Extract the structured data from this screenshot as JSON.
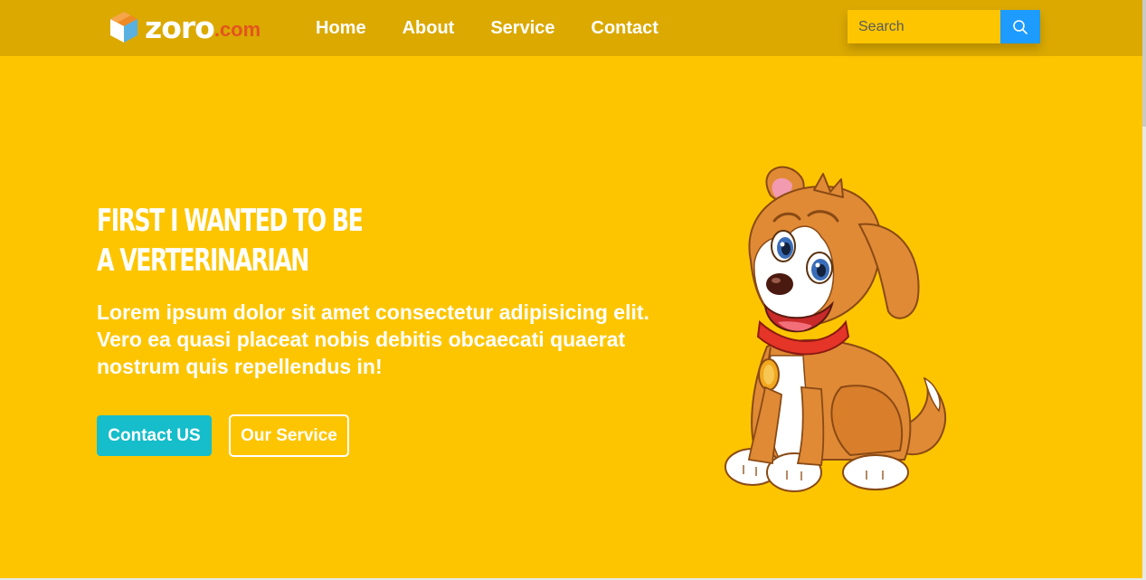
{
  "header": {
    "logo": {
      "name": "zoro",
      "suffix": ".com"
    },
    "nav": [
      {
        "label": "Home"
      },
      {
        "label": "About"
      },
      {
        "label": "Service"
      },
      {
        "label": "Contact"
      }
    ],
    "search": {
      "placeholder": "Search",
      "value": ""
    }
  },
  "hero": {
    "title_line1": "FIRST I WANTED TO BE",
    "title_line2": "A VERTERINARIAN",
    "text": "Lorem ipsum dolor sit amet consectetur adipisicing elit. Vero ea quasi placeat nobis debitis obcaecati quaerat nostrum quis repellendus in!",
    "contact_button": "Contact US",
    "service_button": "Our Service"
  },
  "icons": {
    "logo": "cube-logo-icon",
    "search": "search-icon",
    "illustration": "cartoon-dog-illustration"
  },
  "colors": {
    "background": "#fdc500",
    "navbar": "#dba900",
    "search_button": "#1e9bff",
    "contact_button": "#16bdca",
    "logo_accent": "#e4541f"
  }
}
